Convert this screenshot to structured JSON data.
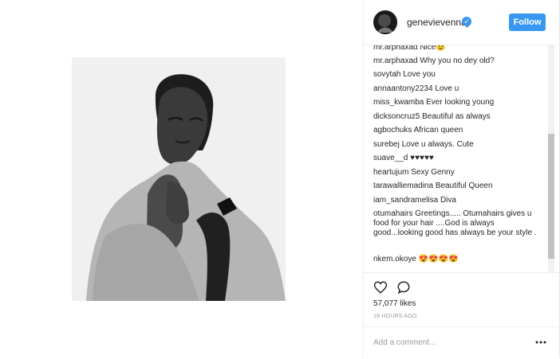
{
  "header": {
    "username": "genevievennaji",
    "follow_label": "Follow"
  },
  "comments": [
    {
      "user": "mr.arphaxad",
      "text": "Nice😉"
    },
    {
      "user": "mr.arphaxad",
      "text": "Why you no dey old?"
    },
    {
      "user": "sovytah",
      "text": "Love you"
    },
    {
      "user": "annaantony2234",
      "text": "Love u"
    },
    {
      "user": "miss_kwamba",
      "text": "Ever looking young"
    },
    {
      "user": "dicksoncruz5",
      "text": "Beautiful as always"
    },
    {
      "user": "agbochuks",
      "text": "African queen"
    },
    {
      "user": "surebej",
      "text": "Love u always. Cute"
    },
    {
      "user": "suave__d",
      "text": "♥♥♥♥♥"
    },
    {
      "user": "heartujum",
      "text": "Sexy Genny"
    },
    {
      "user": "tarawalliemadina",
      "text": "Beautiful Queen"
    },
    {
      "user": "iam_sandramelisa",
      "text": "Diva"
    },
    {
      "user": "otumahairs",
      "text": "Greetings..... Otumahairs gives u food for your hair ....God is always good...looking good has always be your style ."
    },
    {
      "user": "nkem.okoye",
      "text": "😍😍😍😍"
    }
  ],
  "likes": "57,077 likes",
  "time": "18 HOURS AGO",
  "add_comment": {
    "placeholder": "Add a comment..."
  },
  "colors": {
    "follow": "#3897f0",
    "text": "#262626",
    "muted": "#999999"
  },
  "icons": [
    "heart-icon",
    "comment-icon",
    "more-icon",
    "verified-badge-icon"
  ]
}
